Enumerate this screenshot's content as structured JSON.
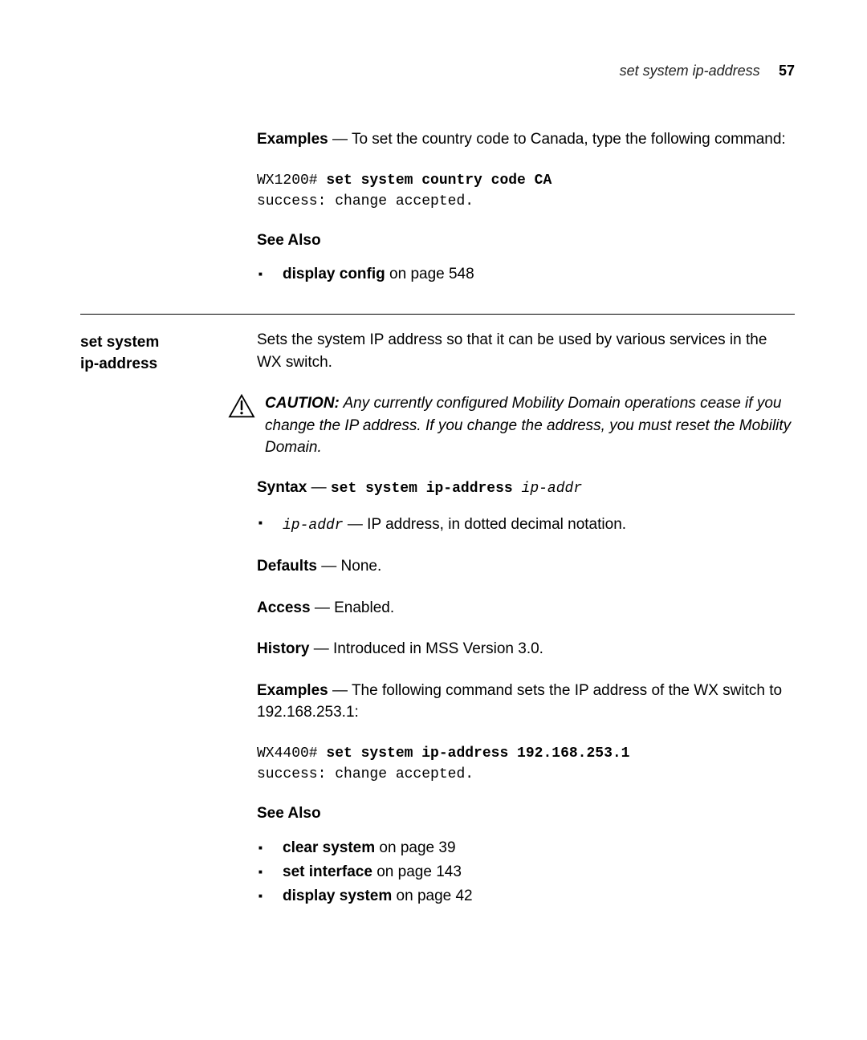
{
  "header": {
    "title": "set system ip-address",
    "page": "57"
  },
  "block1": {
    "examples_label": "Examples",
    "examples_text": " — To set the country code to Canada, type the following command:",
    "code_prompt": "WX1200# ",
    "code_cmd": "set system country code CA",
    "code_result": "success: change accepted.",
    "see_also_label": "See Also",
    "link1_cmd": "display config",
    "link1_text": " on page 548"
  },
  "sidebar": {
    "title_line1": "set system",
    "title_line2": "ip-address"
  },
  "block2": {
    "intro": "Sets the system IP address so that it can be used by various services in the WX switch.",
    "caution_label": "CAUTION:",
    "caution_text": " Any currently configured Mobility Domain operations cease if you change the IP address. If you change the address, you must reset the Mobility Domain.",
    "syntax_label": "Syntax",
    "syntax_dash": " — ",
    "syntax_cmd": "set system ip-address ",
    "syntax_param": "ip-addr",
    "param_name": "ip-addr",
    "param_text": " — IP address, in dotted decimal notation.",
    "defaults_label": "Defaults",
    "defaults_text": " — None.",
    "access_label": "Access",
    "access_text": " — Enabled.",
    "history_label": "History",
    "history_text": " — Introduced in MSS Version 3.0.",
    "examples_label": "Examples",
    "examples_text": " — The following command sets the IP address of the WX switch to 192.168.253.1:",
    "code_prompt": "WX4400# ",
    "code_cmd": "set system ip-address 192.168.253.1",
    "code_result": "success: change accepted.",
    "see_also_label": "See Also",
    "link1_cmd": "clear system",
    "link1_text": " on page 39",
    "link2_cmd": "set interface",
    "link2_text": " on page 143",
    "link3_cmd": "display system",
    "link3_text": " on page 42"
  }
}
